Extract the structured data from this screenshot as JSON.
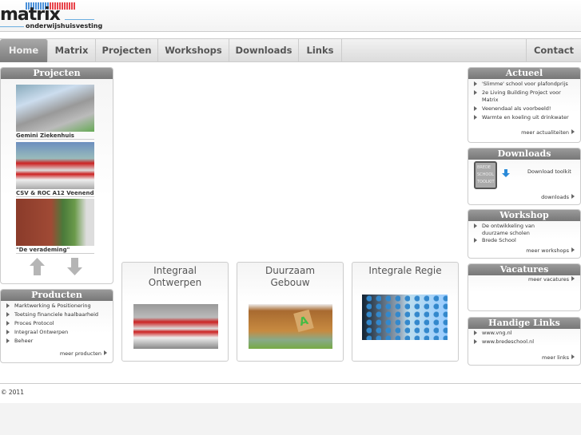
{
  "logo": {
    "name": "matrix",
    "tagline": "onderwijshuisvesting"
  },
  "nav": {
    "items": [
      "Home",
      "Matrix",
      "Projecten",
      "Workshops",
      "Downloads",
      "Links"
    ],
    "contact": "Contact",
    "active": "Home"
  },
  "projecten": {
    "title": "Projecten",
    "items": [
      {
        "caption": "Gemini Ziekenhuis"
      },
      {
        "caption": "CSV & ROC A12 Veenendaal"
      },
      {
        "caption": "\"De verademing\""
      }
    ]
  },
  "producten": {
    "title": "Producten",
    "items": [
      "Marktwerking & Positionering",
      "Toetsing financiele haalbaarheid",
      "Proces Protocol",
      "Integraal Ontwerpen",
      "Beheer"
    ],
    "more": "meer producten"
  },
  "cards": [
    {
      "title": "Integraal Ontwerpen"
    },
    {
      "title": "Duurzaam Gebouw"
    },
    {
      "title": "Integrale Regie"
    }
  ],
  "actueel": {
    "title": "Actueel",
    "items": [
      "'Slimme' school voor plafondprijs",
      "2e Living Building Project voor Matrix",
      "Veenendaal als voorbeeld!",
      "Warmte en koeling uit drinkwater"
    ],
    "more": "meer actualiteiten"
  },
  "downloads": {
    "title": "Downloads",
    "toolkit_lines": [
      "BREDE",
      "SCHOOL",
      "TOOLKIT"
    ],
    "link": "Download toolkit",
    "more": "downloads"
  },
  "workshop": {
    "title": "Workshop",
    "items": [
      "De ontwikkeling van duurzame scholen",
      "Brede School"
    ],
    "more": "meer workshops"
  },
  "vacatures": {
    "title": "Vacatures",
    "more": "meer vacatures"
  },
  "links": {
    "title": "Handige Links",
    "items": [
      "www.vng.nl",
      "www.bredeschool.nl"
    ],
    "more": "meer links"
  },
  "footer": {
    "copyright": "© 2011"
  }
}
